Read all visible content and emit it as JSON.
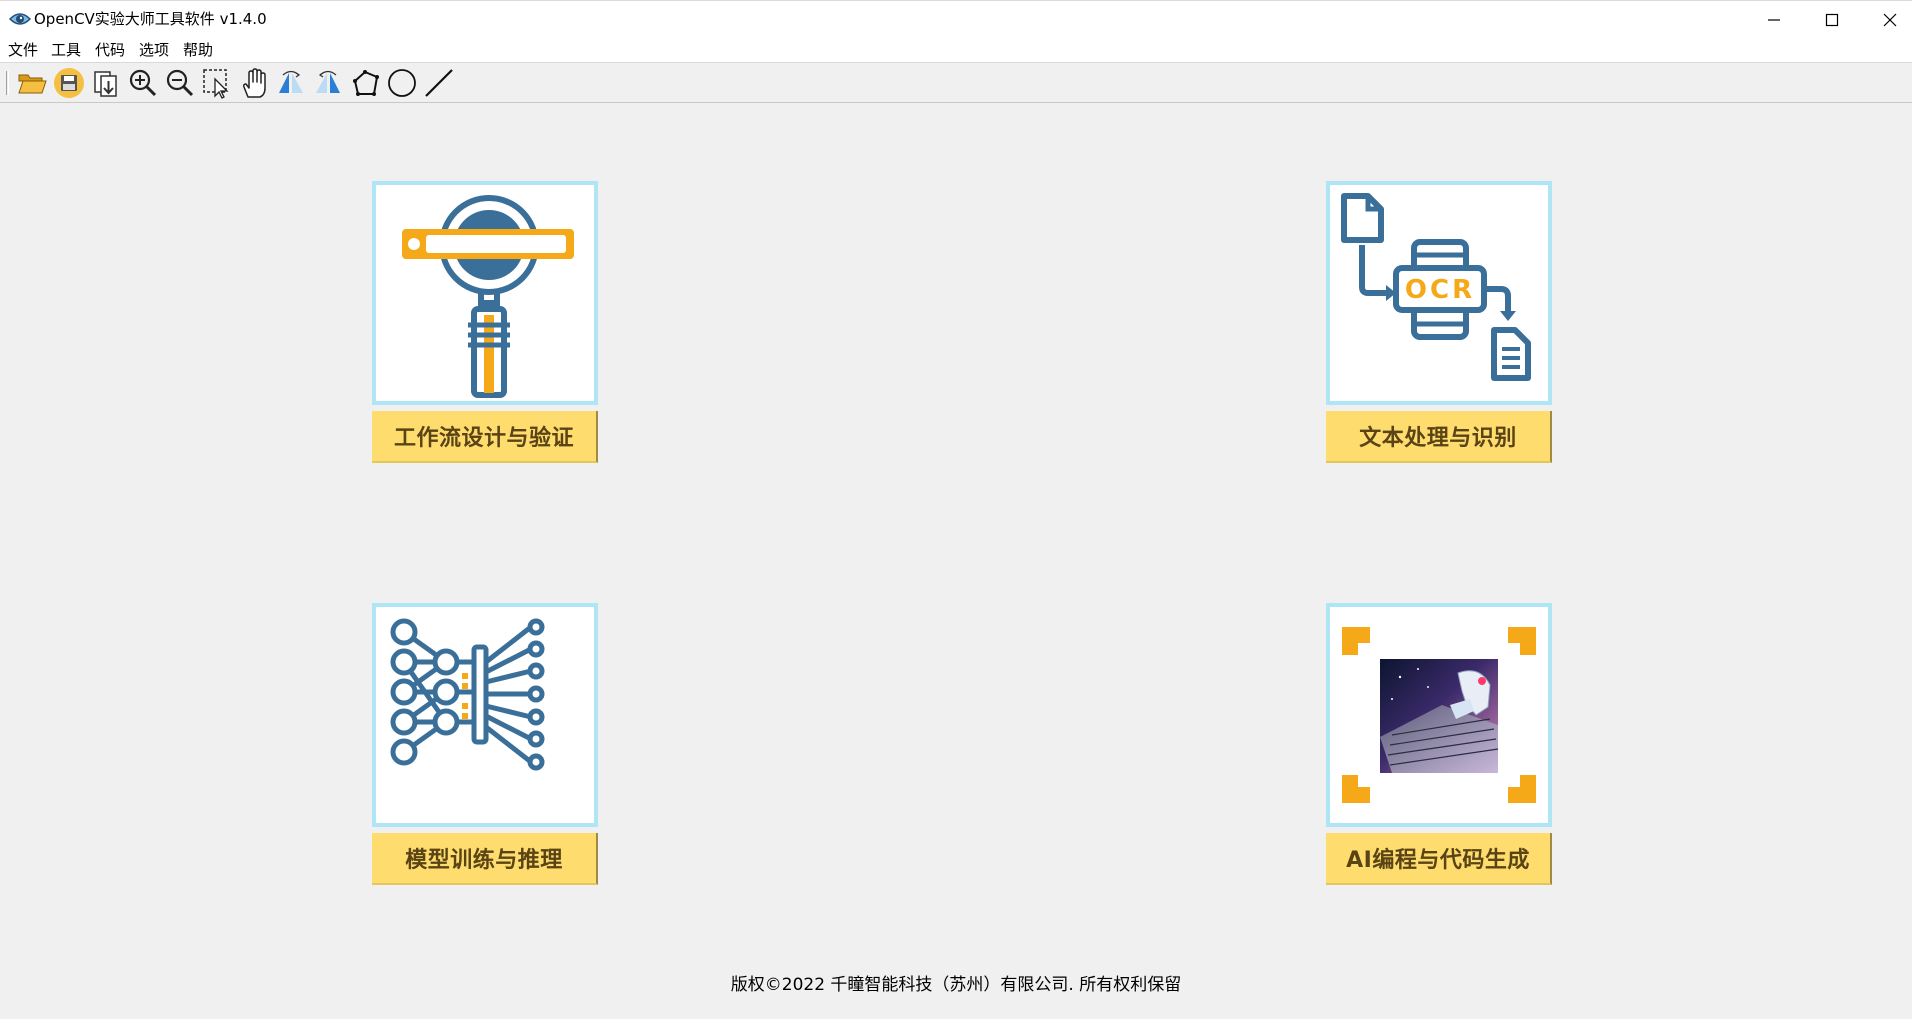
{
  "window": {
    "title": "OpenCV实验大师工具软件 v1.4.0",
    "controls": [
      "minimize-icon",
      "maximize-icon",
      "close-icon"
    ]
  },
  "menu": {
    "items": [
      {
        "label": "文件"
      },
      {
        "label": "工具"
      },
      {
        "label": "代码"
      },
      {
        "label": "选项"
      },
      {
        "label": "帮助"
      }
    ]
  },
  "toolbar": {
    "icons": [
      "open-folder-icon",
      "save-icon",
      "export-icon",
      "zoom-in-icon",
      "zoom-out-icon",
      "select-icon",
      "pan-hand-icon",
      "flip-left-icon",
      "flip-right-icon",
      "polygon-icon",
      "circle-icon",
      "line-icon"
    ]
  },
  "cards": [
    {
      "label": "工作流设计与验证",
      "icon": "magnifier-workflow-icon"
    },
    {
      "label": "文本处理与识别",
      "icon": "ocr-document-icon",
      "icon_text": "OCR"
    },
    {
      "label": "模型训练与推理",
      "icon": "neural-network-icon"
    },
    {
      "label": "AI编程与代码生成",
      "icon": "ai-robot-keyboard-image"
    }
  ],
  "colors": {
    "card_border": "#aee6f6",
    "label_bg": "#fedd6e",
    "label_text": "#5a4315",
    "icon_blue": "#3a6f99",
    "icon_orange": "#f5a918"
  },
  "footer": {
    "copyright": "版权©2022 千瞳智能科技（苏州）有限公司. 所有权利保留"
  }
}
